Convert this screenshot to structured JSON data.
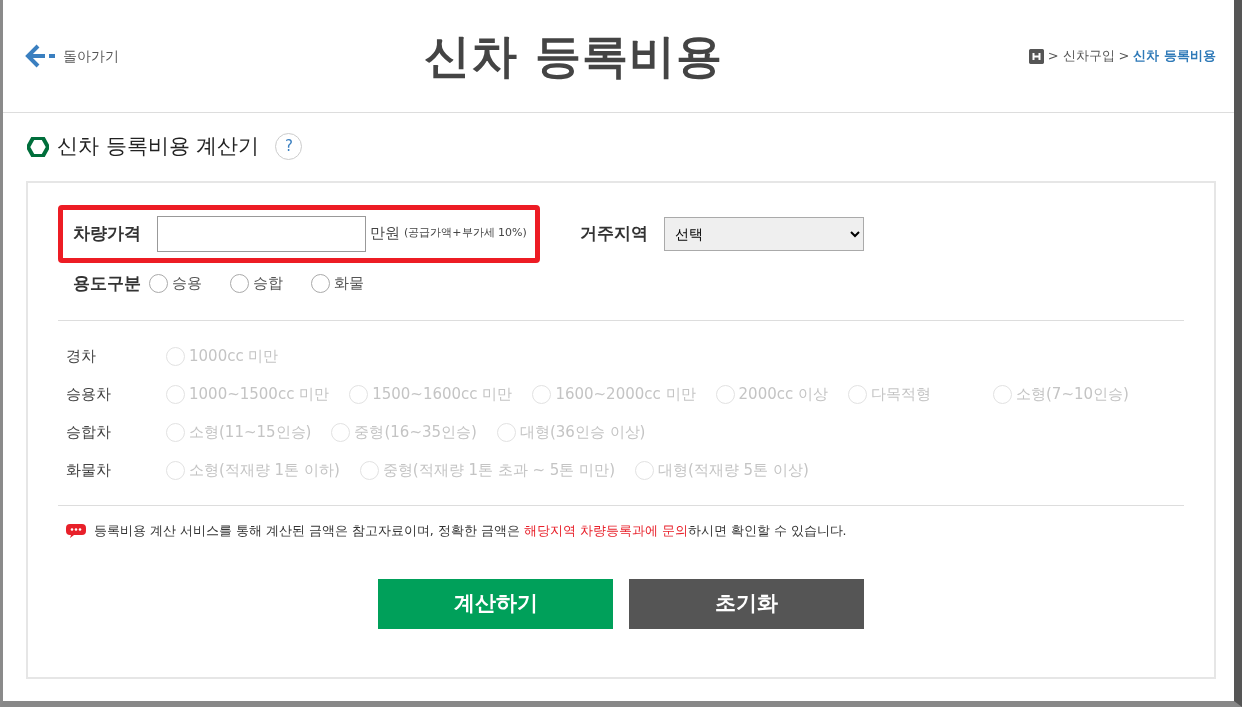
{
  "header": {
    "back_label": "돌아가기",
    "title": "신차 등록비용",
    "breadcrumb": [
      {
        "separator": ">",
        "label": "신차구입",
        "current": false
      },
      {
        "separator": ">",
        "label": "신차 등록비용",
        "current": true
      }
    ]
  },
  "section": {
    "title": "신차 등록비용 계산기",
    "help": "?"
  },
  "price": {
    "label": "차량가격",
    "unit": "만원",
    "note": "(공급가액+부가세 10%)",
    "highlighted": true
  },
  "region": {
    "label": "거주지역",
    "value": "선택"
  },
  "usage": {
    "label": "용도구분",
    "options": [
      {
        "label": "승용",
        "selected": false
      },
      {
        "label": "승합",
        "selected": false
      },
      {
        "label": "화물",
        "selected": false
      }
    ]
  },
  "vehicle_classes": [
    {
      "label": "경차",
      "options": [
        {
          "label": "1000cc 미만",
          "selected": false,
          "disabled": true
        }
      ]
    },
    {
      "label": "승용차",
      "options": [
        {
          "label": "1000~1500cc 미만",
          "selected": false,
          "disabled": true
        },
        {
          "label": "1500~1600cc 미만",
          "selected": false,
          "disabled": true
        },
        {
          "label": "1600~2000cc 미만",
          "selected": false,
          "disabled": true
        },
        {
          "label": "2000cc 이상",
          "selected": false,
          "disabled": true
        },
        {
          "label": "다목적형",
          "selected": false,
          "disabled": true
        },
        {
          "label": "소형(7~10인승)",
          "selected": false,
          "disabled": true
        }
      ]
    },
    {
      "label": "승합차",
      "options": [
        {
          "label": "소형(11~15인승)",
          "selected": false,
          "disabled": true
        },
        {
          "label": "중형(16~35인승)",
          "selected": false,
          "disabled": true
        },
        {
          "label": "대형(36인승 이상)",
          "selected": false,
          "disabled": true
        }
      ]
    },
    {
      "label": "화물차",
      "options": [
        {
          "label": "소형(적재량 1톤 이하)",
          "selected": false,
          "disabled": true
        },
        {
          "label": "중형(적재량 1톤 초과 ~ 5톤 미만)",
          "selected": false,
          "disabled": true
        },
        {
          "label": "대형(적재량 5톤 이상)",
          "selected": false,
          "disabled": true
        }
      ]
    }
  ],
  "notice": [
    {
      "text": "등록비용 계산 서비스를 통해 계산된 금액은 참고자료이며, 정확한 금액은 ",
      "kind": "plain"
    },
    {
      "text": "해당지역 차량등록과에 문의",
      "kind": "highlight"
    },
    {
      "text": "하시면 확인할 수 있습니다.",
      "kind": "plain"
    }
  ],
  "buttons": [
    {
      "label": "계산하기",
      "kind": "primary"
    },
    {
      "label": "초기화",
      "kind": "secondary"
    }
  ]
}
